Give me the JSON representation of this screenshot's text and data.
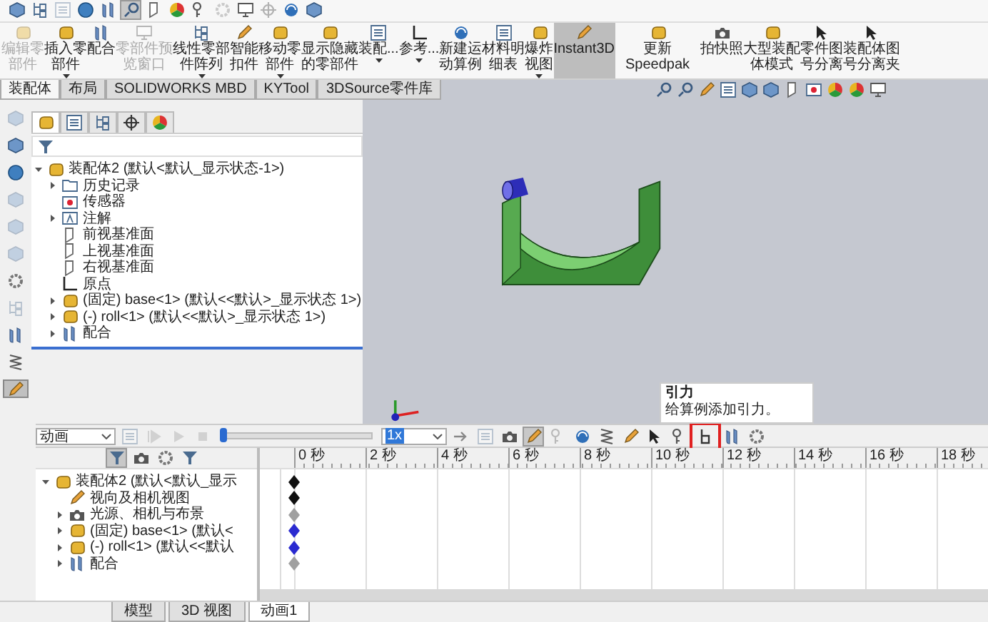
{
  "top_toolbar": [
    {
      "kind": "cube",
      "selected": false,
      "disabled": false
    },
    {
      "kind": "tree",
      "selected": false,
      "disabled": false
    },
    {
      "kind": "list",
      "selected": false,
      "disabled": true
    },
    {
      "kind": "sphere",
      "selected": false,
      "disabled": false
    },
    {
      "kind": "clip",
      "selected": false,
      "disabled": false
    },
    {
      "kind": "search",
      "selected": true,
      "disabled": false
    },
    {
      "kind": "plane",
      "selected": false,
      "disabled": false
    },
    {
      "kind": "colorwheel",
      "selected": false,
      "disabled": false
    },
    {
      "kind": "key",
      "selected": false,
      "disabled": false
    },
    {
      "kind": "gear",
      "selected": false,
      "disabled": true
    },
    {
      "kind": "monitor",
      "selected": false,
      "disabled": false
    },
    {
      "kind": "crosshair",
      "selected": false,
      "disabled": true
    },
    {
      "kind": "motor",
      "selected": false,
      "disabled": false
    },
    {
      "kind": "cube",
      "selected": false,
      "disabled": false
    }
  ],
  "ribbon": [
    {
      "label": "编辑零部件",
      "kind": "part",
      "disabled": true,
      "selected": false,
      "dropdown": false
    },
    {
      "label": "插入零部件",
      "kind": "part",
      "disabled": false,
      "selected": false,
      "dropdown": true
    },
    {
      "label": "配合",
      "kind": "clip",
      "disabled": false,
      "selected": false,
      "dropdown": false
    },
    {
      "label": "零部件预览窗口",
      "kind": "monitor",
      "disabled": true,
      "selected": false,
      "dropdown": false
    },
    {
      "label": "线性零部件阵列",
      "kind": "tree",
      "disabled": false,
      "selected": false,
      "dropdown": true
    },
    {
      "label": "智能扣件",
      "kind": "pencil",
      "disabled": false,
      "selected": false,
      "dropdown": false
    },
    {
      "label": "移动零部件",
      "kind": "part",
      "disabled": false,
      "selected": false,
      "dropdown": true
    },
    {
      "label": "显示隐藏的零部件",
      "kind": "part",
      "disabled": false,
      "selected": false,
      "dropdown": false
    },
    {
      "label": "装配...",
      "kind": "list",
      "disabled": false,
      "selected": false,
      "dropdown": true
    },
    {
      "label": "参考...",
      "kind": "origin",
      "disabled": false,
      "selected": false,
      "dropdown": true
    },
    {
      "label": "新建运动算例",
      "kind": "motor",
      "disabled": false,
      "selected": false,
      "dropdown": false
    },
    {
      "label": "材料明细表",
      "kind": "list",
      "disabled": false,
      "selected": false,
      "dropdown": false
    },
    {
      "label": "爆炸视图",
      "kind": "part",
      "disabled": false,
      "selected": false,
      "dropdown": true
    },
    {
      "label": "Instant3D",
      "kind": "pencil",
      "disabled": false,
      "selected": true,
      "dropdown": false
    },
    {
      "label": "更新 Speedpak",
      "kind": "part",
      "disabled": false,
      "selected": false,
      "dropdown": false
    },
    {
      "label": "拍快照",
      "kind": "camera",
      "disabled": false,
      "selected": false,
      "dropdown": false
    },
    {
      "label": "大型装配体模式",
      "kind": "part",
      "disabled": false,
      "selected": false,
      "dropdown": false
    },
    {
      "label": "零件图号分离",
      "kind": "cursor",
      "disabled": false,
      "selected": false,
      "dropdown": false
    },
    {
      "label": "装配体图号分离夹",
      "kind": "cursor",
      "disabled": false,
      "selected": false,
      "dropdown": false
    }
  ],
  "tabs": [
    {
      "label": "装配体",
      "selected": true
    },
    {
      "label": "布局",
      "selected": false
    },
    {
      "label": "SOLIDWORKS MBD",
      "selected": false
    },
    {
      "label": "KYTool",
      "selected": false
    },
    {
      "label": "3DSource零件库",
      "selected": false
    }
  ],
  "view_toolbar": [
    {
      "kind": "search"
    },
    {
      "kind": "search"
    },
    {
      "kind": "pencil"
    },
    {
      "kind": "list"
    },
    {
      "kind": "cube"
    },
    {
      "kind": "cube"
    },
    {
      "kind": "plane"
    },
    {
      "kind": "sensor"
    },
    {
      "kind": "colorwheel"
    },
    {
      "kind": "colorwheel"
    },
    {
      "kind": "monitor"
    }
  ],
  "left_tools": [
    {
      "kind": "cube",
      "disabled": true,
      "selected": false
    },
    {
      "kind": "cube",
      "disabled": false,
      "selected": false
    },
    {
      "kind": "sphere",
      "disabled": false,
      "selected": false
    },
    {
      "kind": "cube",
      "disabled": true,
      "selected": false
    },
    {
      "kind": "cube",
      "disabled": true,
      "selected": false
    },
    {
      "kind": "cube",
      "disabled": true,
      "selected": false
    },
    {
      "kind": "gear",
      "disabled": false,
      "selected": false
    },
    {
      "kind": "tree",
      "disabled": true,
      "selected": false
    },
    {
      "kind": "clip",
      "disabled": false,
      "selected": false
    },
    {
      "kind": "spring",
      "disabled": false,
      "selected": false
    },
    {
      "kind": "pencil",
      "disabled": false,
      "selected": true
    }
  ],
  "panel_tabs": [
    {
      "kind": "part",
      "selected": true
    },
    {
      "kind": "list",
      "selected": false
    },
    {
      "kind": "tree",
      "selected": false
    },
    {
      "kind": "crosshair",
      "selected": false
    },
    {
      "kind": "colorwheel",
      "selected": false
    }
  ],
  "feature_tree": {
    "label": "装配体2 (默认<默认_显示状态-1>)",
    "kind": "part",
    "expanded": true,
    "children": [
      {
        "label": "历史记录",
        "kind": "folder",
        "expanded": false
      },
      {
        "label": "传感器",
        "kind": "sensor"
      },
      {
        "label": "注解",
        "kind": "annotation",
        "expanded": false
      },
      {
        "label": "前视基准面",
        "kind": "plane"
      },
      {
        "label": "上视基准面",
        "kind": "plane"
      },
      {
        "label": "右视基准面",
        "kind": "plane"
      },
      {
        "label": "原点",
        "kind": "origin"
      },
      {
        "label": "(固定) base<1> (默认<<默认>_显示状态 1>)",
        "kind": "part",
        "expanded": false
      },
      {
        "label": "(-) roll<1> (默认<<默认>_显示状态 1>)",
        "kind": "part",
        "expanded": false
      },
      {
        "label": "配合",
        "kind": "clip",
        "expanded": false
      }
    ]
  },
  "animation": {
    "study_type": "动画",
    "timeline_slider": {
      "level": 0
    },
    "speed": "1x",
    "tools": [
      {
        "kind": "arrow",
        "disabled": false,
        "selected": false,
        "highlighted": false
      },
      {
        "kind": "list",
        "disabled": true,
        "selected": false,
        "highlighted": false
      },
      {
        "kind": "camera",
        "disabled": false,
        "selected": false,
        "highlighted": false
      },
      {
        "kind": "pencil",
        "disabled": false,
        "selected": true,
        "highlighted": false
      },
      {
        "kind": "key",
        "disabled": true,
        "selected": false,
        "highlighted": false
      },
      {
        "kind": "motor",
        "disabled": false,
        "selected": false,
        "highlighted": false
      },
      {
        "kind": "spring",
        "disabled": false,
        "selected": false,
        "highlighted": false
      },
      {
        "kind": "pencil",
        "disabled": false,
        "selected": false,
        "highlighted": false
      },
      {
        "kind": "cursor",
        "disabled": false,
        "selected": false,
        "highlighted": false
      },
      {
        "kind": "key",
        "disabled": false,
        "selected": false,
        "highlighted": false
      },
      {
        "kind": "gravity",
        "disabled": false,
        "selected": false,
        "highlighted": true
      },
      {
        "kind": "clip",
        "disabled": false,
        "selected": false,
        "highlighted": false
      },
      {
        "kind": "gear",
        "disabled": false,
        "selected": false,
        "highlighted": false
      }
    ],
    "tooltip": {
      "title": "引力",
      "text": "给算例添加引力。"
    },
    "tree": {
      "label": "装配体2 (默认<默认_显示",
      "kind": "part",
      "expanded": true,
      "color": "#101010",
      "children": [
        {
          "label": "视向及相机视图",
          "kind": "pencil",
          "color": "#101010"
        },
        {
          "label": "光源、相机与布景",
          "kind": "camera",
          "expanded": false,
          "color": "#a0a0a0"
        },
        {
          "label": "(固定) base<1> (默认<",
          "kind": "part",
          "expanded": false,
          "color": "#2a2ad0"
        },
        {
          "label": "(-) roll<1> (默认<<默认",
          "kind": "part",
          "expanded": false,
          "color": "#2a2ad0"
        },
        {
          "label": "配合",
          "kind": "clip",
          "expanded": false,
          "color": "#a0a0a0"
        }
      ]
    },
    "ticks": [
      "0 秒",
      "2 秒",
      "4 秒",
      "6 秒",
      "8 秒",
      "10 秒",
      "12 秒",
      "14 秒",
      "16 秒",
      "18 秒"
    ]
  },
  "bottom_tabs": [
    {
      "label": "模型",
      "selected": false
    },
    {
      "label": "3D 视图",
      "selected": false
    },
    {
      "label": "动画1",
      "selected": true
    }
  ]
}
